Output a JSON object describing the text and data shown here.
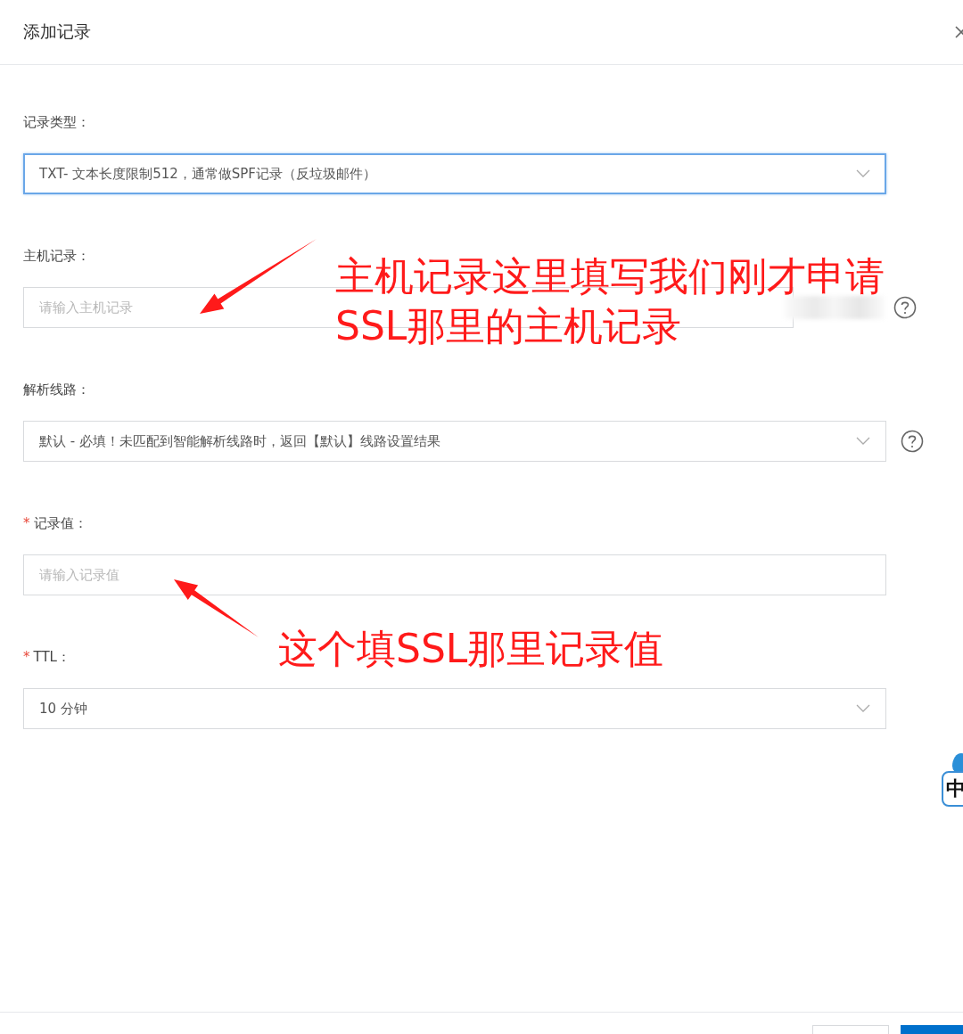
{
  "dialog": {
    "title": "添加记录"
  },
  "fields": [
    {
      "label": "记录类型：",
      "kind": "select",
      "value": "TXT- 文本长度限制512，通常做SPF记录（反垃圾邮件）",
      "focused": true,
      "help": false,
      "redacted": false
    },
    {
      "label": "主机记录：",
      "kind": "input",
      "placeholder": "请输入主机记录",
      "focused": false,
      "help": true,
      "redacted": true
    },
    {
      "label": "解析线路：",
      "kind": "select",
      "value": "默认 - 必填！未匹配到智能解析线路时，返回【默认】线路设置结果",
      "focused": false,
      "help": true,
      "redacted": false
    },
    {
      "label": "记录值：",
      "required_mark": "*",
      "kind": "input",
      "placeholder": "请输入记录值",
      "focused": false,
      "help": false,
      "redacted": false
    },
    {
      "label": "TTL：",
      "required_mark": "*",
      "kind": "select",
      "value": "10 分钟",
      "focused": false,
      "help": false,
      "redacted": false
    }
  ],
  "annotations": [
    {
      "lines": [
        "主机记录这里填写我们刚才申请",
        "SSL那里的主机记录"
      ]
    },
    {
      "lines": [
        "这个填SSL那里记录值"
      ]
    }
  ],
  "ime_indicator": "中"
}
